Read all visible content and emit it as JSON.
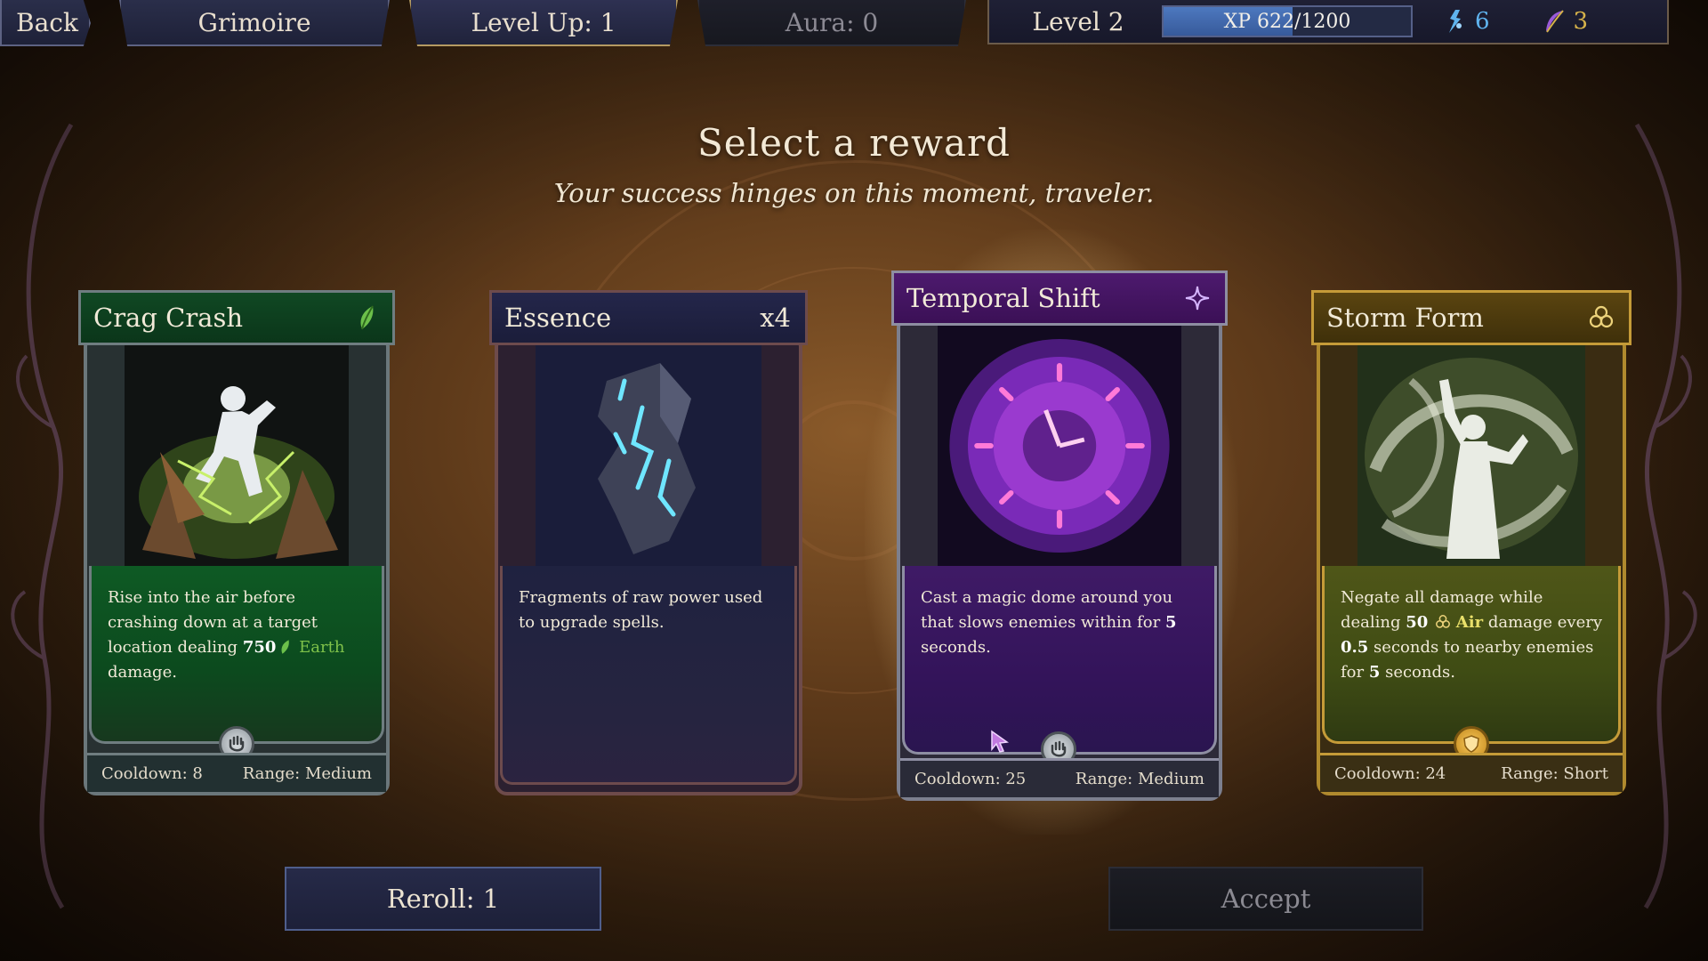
{
  "topbar": {
    "back_label": "Back",
    "grimoire_label": "Grimoire",
    "levelup_label": "Level Up: 1",
    "aura_label": "Aura: 0",
    "level_label": "Level 2",
    "xp_text": "XP 622/1200",
    "xp_fraction": 0.52,
    "crystals": "6",
    "feathers": "3"
  },
  "heading": {
    "title": "Select a reward",
    "subtitle": "Your success hinges on this moment, traveler."
  },
  "cards": [
    {
      "name": "Crag Crash",
      "theme": "green",
      "icon": "leaf-icon",
      "desc_parts": [
        "Rise into the air before crashing down at a target location dealing ",
        "750",
        "Earth",
        " damage."
      ],
      "cooldown": "Cooldown: 8",
      "range": "Range: Medium"
    },
    {
      "name": "Essence",
      "theme": "blue",
      "count": "x4",
      "desc": "Fragments of raw power used to upgrade spells."
    },
    {
      "name": "Temporal Shift",
      "theme": "purple",
      "icon": "sparkle-icon",
      "desc_parts": [
        "Cast a magic dome around you that slows enemies within for ",
        "5",
        " seconds."
      ],
      "cooldown": "Cooldown: 25",
      "range": "Range: Medium"
    },
    {
      "name": "Storm Form",
      "theme": "gold",
      "icon": "triskelion-icon",
      "desc_parts": [
        "Negate all damage while dealing ",
        "50",
        "Air",
        " damage every ",
        "0.5",
        " seconds to nearby enemies for ",
        "5",
        " seconds."
      ],
      "cooldown": "Cooldown: 24",
      "range": "Range: Short"
    }
  ],
  "buttons": {
    "reroll_label": "Reroll: 1",
    "accept_label": "Accept"
  },
  "colors": {
    "earth": "#7fc24a",
    "air": "#e9e06a",
    "crystal": "#5fb3ee",
    "feather": "#d6b24a"
  }
}
